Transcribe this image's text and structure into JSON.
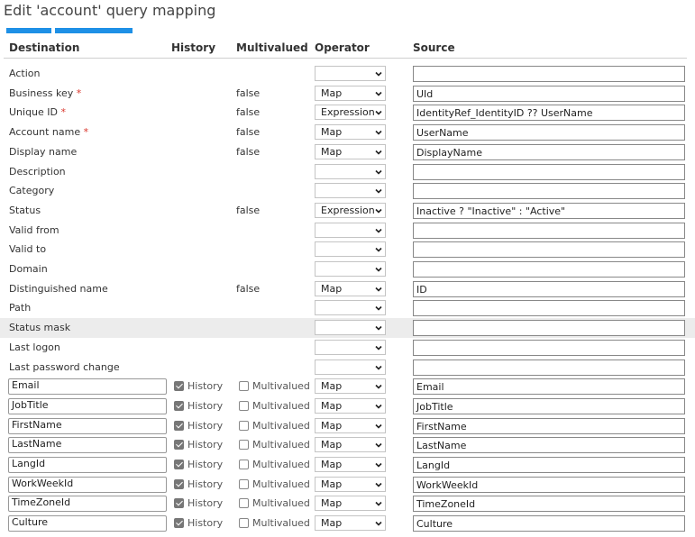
{
  "title": "Edit 'account' query mapping",
  "columns": {
    "destination": "Destination",
    "history": "History",
    "multivalued": "Multivalued",
    "operator": "Operator",
    "source": "Source"
  },
  "required_mark": "*",
  "checkbox_labels": {
    "history": "History",
    "multivalued": "Multivalued"
  },
  "fixed_rows": [
    {
      "label": "Action",
      "required": false,
      "multivalued": "",
      "operator": "",
      "source": ""
    },
    {
      "label": "Business key",
      "required": true,
      "multivalued": "false",
      "operator": "Map",
      "source": "UId"
    },
    {
      "label": "Unique ID",
      "required": true,
      "multivalued": "false",
      "operator": "Expression",
      "source": "IdentityRef_IdentityID ?? UserName"
    },
    {
      "label": "Account name",
      "required": true,
      "multivalued": "false",
      "operator": "Map",
      "source": "UserName"
    },
    {
      "label": "Display name",
      "required": false,
      "multivalued": "false",
      "operator": "Map",
      "source": "DisplayName"
    },
    {
      "label": "Description",
      "required": false,
      "multivalued": "",
      "operator": "",
      "source": ""
    },
    {
      "label": "Category",
      "required": false,
      "multivalued": "",
      "operator": "",
      "source": ""
    },
    {
      "label": "Status",
      "required": false,
      "multivalued": "false",
      "operator": "Expression",
      "source": "Inactive ? \"Inactive\" : \"Active\""
    },
    {
      "label": "Valid from",
      "required": false,
      "multivalued": "",
      "operator": "",
      "source": ""
    },
    {
      "label": "Valid to",
      "required": false,
      "multivalued": "",
      "operator": "",
      "source": ""
    },
    {
      "label": "Domain",
      "required": false,
      "multivalued": "",
      "operator": "",
      "source": ""
    },
    {
      "label": "Distinguished name",
      "required": false,
      "multivalued": "false",
      "operator": "Map",
      "source": "ID"
    },
    {
      "label": "Path",
      "required": false,
      "multivalued": "",
      "operator": "",
      "source": ""
    },
    {
      "label": "Status mask",
      "required": false,
      "multivalued": "",
      "operator": "",
      "source": "",
      "highlighted": true
    },
    {
      "label": "Last logon",
      "required": false,
      "multivalued": "",
      "operator": "",
      "source": ""
    },
    {
      "label": "Last password change",
      "required": false,
      "multivalued": "",
      "operator": "",
      "source": ""
    }
  ],
  "custom_rows": [
    {
      "destination": "Email",
      "history": true,
      "multivalued": false,
      "operator": "Map",
      "source": "Email"
    },
    {
      "destination": "JobTitle",
      "history": true,
      "multivalued": false,
      "operator": "Map",
      "source": "JobTitle"
    },
    {
      "destination": "FirstName",
      "history": true,
      "multivalued": false,
      "operator": "Map",
      "source": "FirstName"
    },
    {
      "destination": "LastName",
      "history": true,
      "multivalued": false,
      "operator": "Map",
      "source": "LastName"
    },
    {
      "destination": "LangId",
      "history": true,
      "multivalued": false,
      "operator": "Map",
      "source": "LangId"
    },
    {
      "destination": "WorkWeekId",
      "history": true,
      "multivalued": false,
      "operator": "Map",
      "source": "WorkWeekId"
    },
    {
      "destination": "TimeZoneId",
      "history": true,
      "multivalued": false,
      "operator": "Map",
      "source": "TimeZoneId"
    },
    {
      "destination": "Culture",
      "history": true,
      "multivalued": false,
      "operator": "Map",
      "source": "Culture"
    }
  ],
  "colors": {
    "accent": "#1e90e6",
    "required": "#d9352b",
    "highlight_row": "#ececec"
  }
}
